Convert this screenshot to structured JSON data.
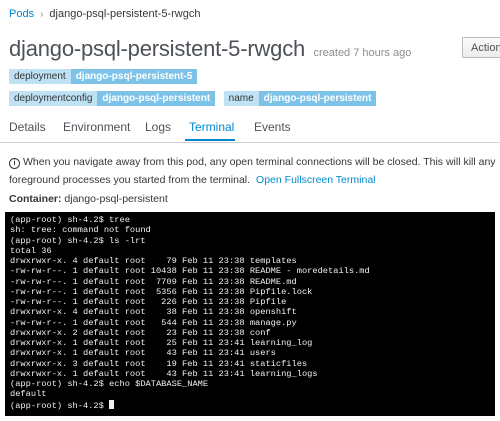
{
  "breadcrumb": {
    "parent": "Pods",
    "separator": "›",
    "current": "django-psql-persistent-5-rwgch"
  },
  "header": {
    "title": "django-psql-persistent-5-rwgch",
    "created": "created 7 hours ago",
    "actions_label": "Actions"
  },
  "labels": [
    {
      "key": "deployment",
      "value": "django-psql-persistent-5"
    },
    {
      "key": "deploymentconfig",
      "value": "django-psql-persistent"
    },
    {
      "key": "name",
      "value": "django-psql-persistent"
    }
  ],
  "tabs": [
    {
      "label": "Details",
      "active": false
    },
    {
      "label": "Environment",
      "active": false
    },
    {
      "label": "Logs",
      "active": false
    },
    {
      "label": "Terminal",
      "active": true
    },
    {
      "label": "Events",
      "active": false
    }
  ],
  "notice": {
    "icon": "info-icon",
    "text": "When you navigate away from this pod, any open terminal connections will be closed. This will kill any foreground processes you started from the terminal.",
    "link": "Open Fullscreen Terminal"
  },
  "container": {
    "label": "Container:",
    "value": "django-psql-persistent"
  },
  "terminal": {
    "lines": [
      "(app-root) sh-4.2$ tree",
      "sh: tree: command not found",
      "(app-root) sh-4.2$ ls -lrt",
      "total 36",
      "drwxrwxr-x. 4 default root    79 Feb 11 23:38 templates",
      "-rw-rw-r--. 1 default root 10438 Feb 11 23:38 README - moredetails.md",
      "-rw-rw-r--. 1 default root  7709 Feb 11 23:38 README.md",
      "-rw-rw-r--. 1 default root  5356 Feb 11 23:38 Pipfile.lock",
      "-rw-rw-r--. 1 default root   226 Feb 11 23:38 Pipfile",
      "drwxrwxr-x. 4 default root    38 Feb 11 23:38 openshift",
      "-rw-rw-r--. 1 default root   544 Feb 11 23:38 manage.py",
      "drwxrwxr-x. 2 default root    23 Feb 11 23:38 conf",
      "drwxrwxr-x. 1 default root    25 Feb 11 23:41 learning_log",
      "drwxrwxr-x. 1 default root    43 Feb 11 23:41 users",
      "drwxrwxr-x. 3 default root    19 Feb 11 23:41 staticfiles",
      "drwxrwxr-x. 1 default root    43 Feb 11 23:41 learning_logs",
      "(app-root) sh-4.2$ echo $DATABASE_NAME",
      "default",
      "(app-root) sh-4.2$ "
    ]
  },
  "colors": {
    "accent": "#0088ce",
    "label_key_bg": "#bee1f4",
    "label_value_bg": "#7dc3e8",
    "terminal_bg": "#000000"
  }
}
